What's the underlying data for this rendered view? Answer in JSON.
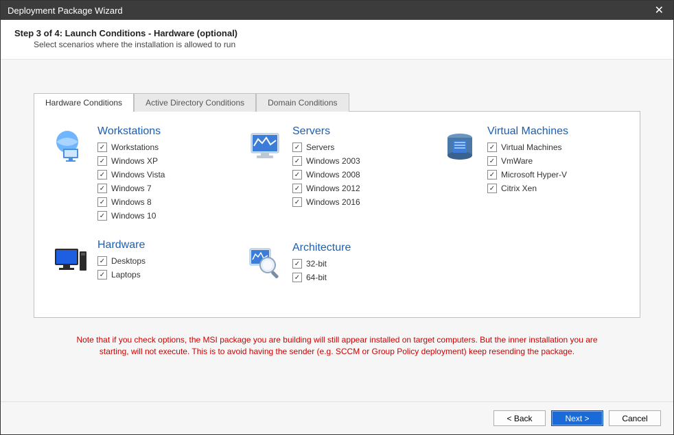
{
  "titlebar": {
    "title": "Deployment Package Wizard"
  },
  "header": {
    "step_title": "Step 3 of 4: Launch Conditions - Hardware (optional)",
    "step_sub": "Select scenarios where the installation is allowed to run"
  },
  "tabs": [
    {
      "label": "Hardware Conditions",
      "active": true
    },
    {
      "label": "Active Directory Conditions",
      "active": false
    },
    {
      "label": "Domain Conditions",
      "active": false
    }
  ],
  "groups": {
    "workstations": {
      "title": "Workstations",
      "items": [
        {
          "label": "Workstations",
          "checked": true
        },
        {
          "label": "Windows XP",
          "checked": true
        },
        {
          "label": "Windows Vista",
          "checked": true
        },
        {
          "label": "Windows 7",
          "checked": true
        },
        {
          "label": "Windows 8",
          "checked": true
        },
        {
          "label": "Windows 10",
          "checked": true
        }
      ]
    },
    "servers": {
      "title": "Servers",
      "items": [
        {
          "label": "Servers",
          "checked": true
        },
        {
          "label": "Windows 2003",
          "checked": true
        },
        {
          "label": "Windows 2008",
          "checked": true
        },
        {
          "label": "Windows 2012",
          "checked": true
        },
        {
          "label": "Windows 2016",
          "checked": true
        }
      ]
    },
    "vm": {
      "title": "Virtual Machines",
      "items": [
        {
          "label": "Virtual Machines",
          "checked": true
        },
        {
          "label": "VmWare",
          "checked": true
        },
        {
          "label": "Microsoft Hyper-V",
          "checked": true
        },
        {
          "label": "Citrix Xen",
          "checked": true
        }
      ]
    },
    "hardware": {
      "title": "Hardware",
      "items": [
        {
          "label": "Desktops",
          "checked": true
        },
        {
          "label": "Laptops",
          "checked": true
        }
      ]
    },
    "arch": {
      "title": "Architecture",
      "items": [
        {
          "label": "32-bit",
          "checked": true
        },
        {
          "label": "64-bit",
          "checked": true
        }
      ]
    }
  },
  "note": "Note that if you check options, the MSI package you are building will still appear installed on target computers. But the inner installation you are starting, will not execute. This is to avoid having the sender (e.g. SCCM or Group Policy deployment) keep resending the package.",
  "buttons": {
    "back": "< Back",
    "next": "Next >",
    "cancel": "Cancel"
  },
  "colors": {
    "accent": "#1a6bd8",
    "link": "#1a5fb4",
    "warning": "#c00"
  }
}
